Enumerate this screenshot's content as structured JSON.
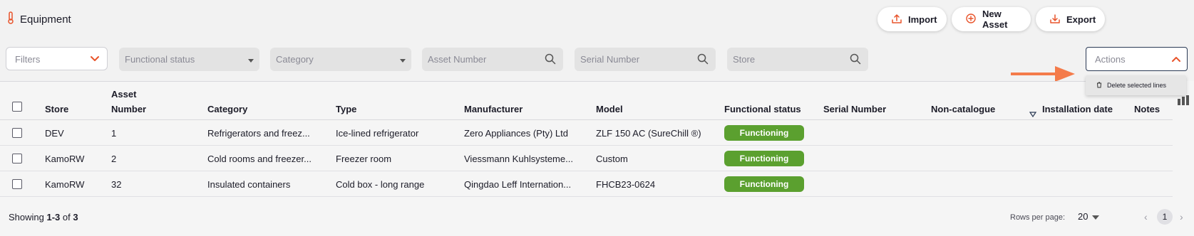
{
  "header": {
    "title": "Equipment",
    "buttons": {
      "import": "Import",
      "new_asset": "New Asset",
      "export": "Export"
    }
  },
  "filters": {
    "filters_label": "Filters",
    "functional_status": "Functional status",
    "category": "Category",
    "asset_number": "Asset Number",
    "serial_number": "Serial Number",
    "store": "Store",
    "actions": "Actions"
  },
  "actions_menu": {
    "delete_selected": "Delete selected lines"
  },
  "table": {
    "columns": {
      "store": "Store",
      "asset_number_line1": "Asset",
      "asset_number_line2": "Number",
      "category": "Category",
      "type": "Type",
      "manufacturer": "Manufacturer",
      "model": "Model",
      "functional_status": "Functional status",
      "serial_number": "Serial Number",
      "non_catalogue": "Non-catalogue",
      "installation_date": "Installation date",
      "notes": "Notes"
    },
    "rows": [
      {
        "store": "DEV",
        "asset_number": "1",
        "category": "Refrigerators and freez...",
        "type": "Ice-lined refrigerator",
        "manufacturer": "Zero Appliances (Pty) Ltd",
        "model": "ZLF 150 AC (SureChill ®)",
        "status": "Functioning"
      },
      {
        "store": "KamoRW",
        "asset_number": "2",
        "category": "Cold rooms and freezer...",
        "type": "Freezer room",
        "manufacturer": "Viessmann Kuhlsysteme...",
        "model": "Custom",
        "status": "Functioning"
      },
      {
        "store": "KamoRW",
        "asset_number": "32",
        "category": "Insulated containers",
        "type": "Cold box - long range",
        "manufacturer": "Qingdao Leff Internation...",
        "model": "FHCB23-0624",
        "status": "Functioning"
      }
    ]
  },
  "footer": {
    "showing_prefix": "Showing ",
    "showing_range": "1-3",
    "showing_of": " of ",
    "showing_total": "3",
    "rows_per_page_label": "Rows per page:",
    "rows_per_page_value": "20",
    "current_page": "1"
  },
  "colors": {
    "accent": "#e8532a",
    "status_green": "#5ba02f",
    "arrow": "#f47b4a"
  },
  "icons": {
    "title": "thermometer-icon",
    "import": "upload-icon",
    "new_asset": "plus-circle-icon",
    "export": "download-icon",
    "search": "search-icon",
    "delete": "trash-icon",
    "columns": "columns-icon"
  }
}
